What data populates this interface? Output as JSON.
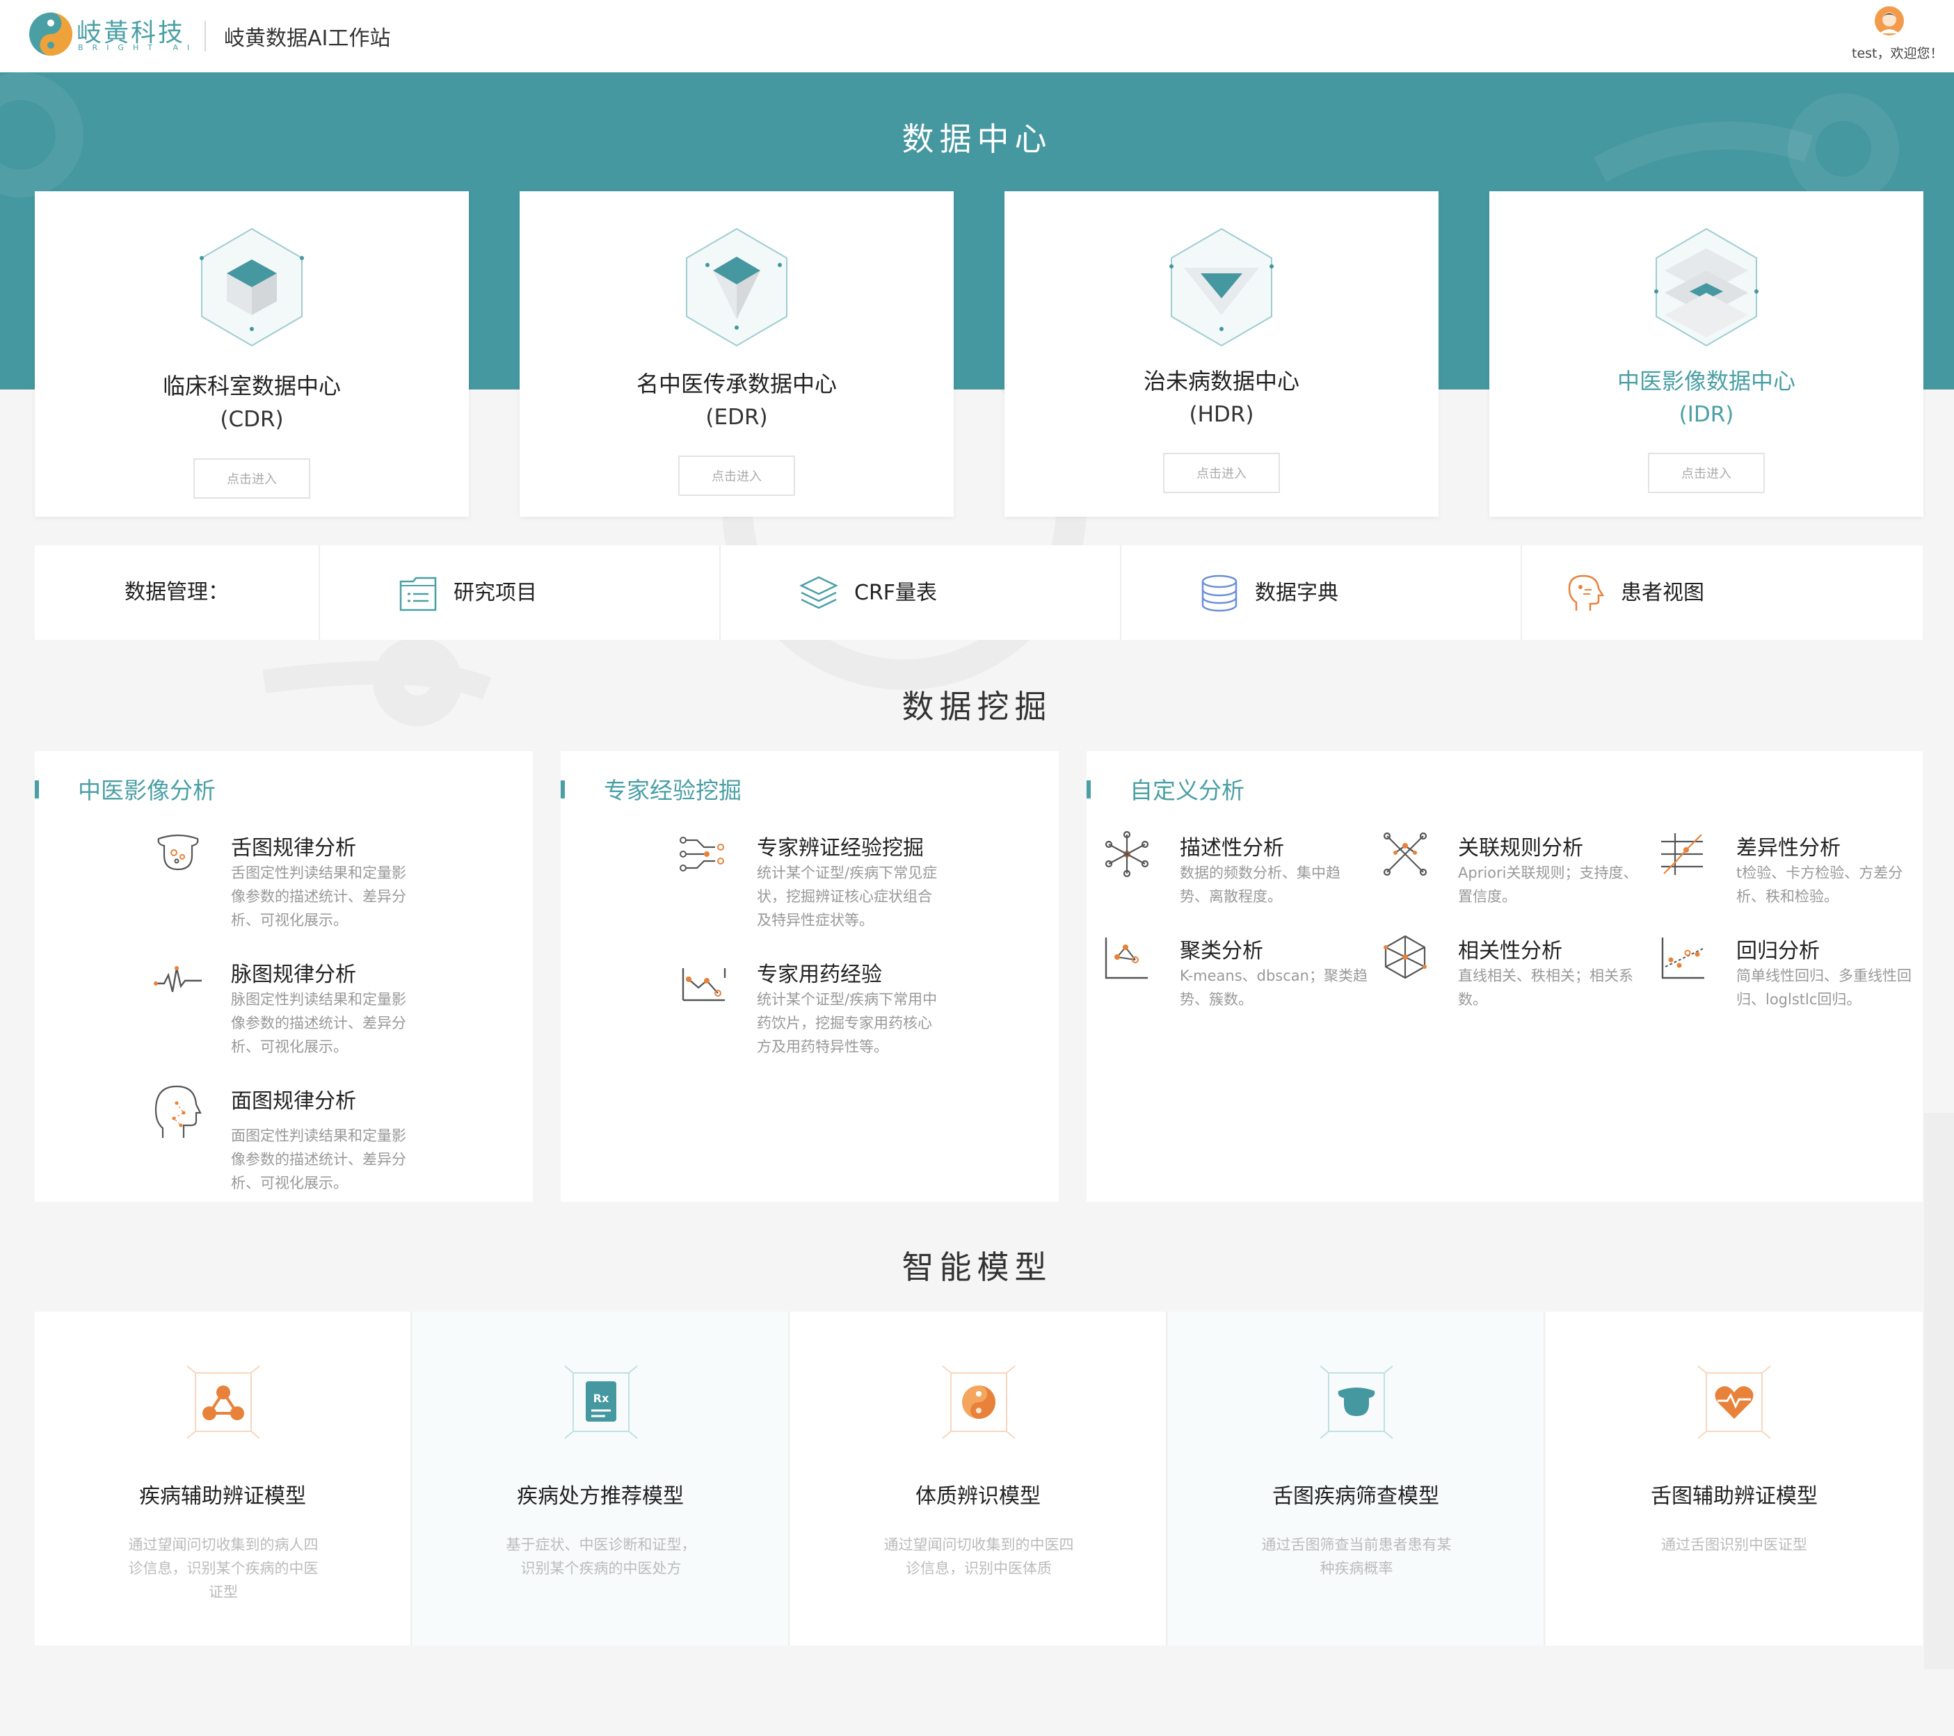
{
  "header": {
    "logo_cn": "岐黃科技",
    "logo_en": "BRIGHT AI",
    "app_title": "岐黄数据AI工作站",
    "welcome": "test，欢迎您！",
    "avatar_icon": "user-avatar-icon"
  },
  "data_center": {
    "title": "数据中心",
    "cards": [
      {
        "name": "临床科室数据中心",
        "code": "(CDR)",
        "button": "点击进入",
        "icon": "cube-layers-icon"
      },
      {
        "name": "名中医传承数据中心",
        "code": "(EDR)",
        "button": "点击进入",
        "icon": "cube-diamond-icon"
      },
      {
        "name": "治未病数据中心",
        "code": "(HDR)",
        "button": "点击进入",
        "icon": "cube-triangle-icon"
      },
      {
        "name": "中医影像数据中心",
        "code": "(IDR)",
        "button": "点击进入",
        "icon": "cube-stack-icon"
      }
    ]
  },
  "data_management": {
    "label": "数据管理：",
    "items": [
      {
        "label": "研究项目",
        "icon": "list-icon"
      },
      {
        "label": "CRF量表",
        "icon": "layers-icon"
      },
      {
        "label": "数据字典",
        "icon": "database-icon"
      },
      {
        "label": "患者视图",
        "icon": "head-profile-icon"
      }
    ]
  },
  "data_mining": {
    "title": "数据挖掘",
    "panels": [
      {
        "title": "中医影像分析",
        "items": [
          {
            "title": "舌图规律分析",
            "desc": "舌图定性判读结果和定量影像参数的描述统计、差异分析、可视化展示。",
            "icon": "tongue-icon"
          },
          {
            "title": "脉图规律分析",
            "desc": "脉图定性判读结果和定量影像参数的描述统计、差异分析、可视化展示。",
            "icon": "pulse-icon"
          },
          {
            "title": "面图规律分析",
            "desc": "面图定性判读结果和定量影像参数的描述统计、差异分析、可视化展示。",
            "icon": "face-icon"
          }
        ]
      },
      {
        "title": "专家经验挖掘",
        "items": [
          {
            "title": "专家辨证经验挖掘",
            "desc": "统计某个证型/疾病下常见症状，挖掘辨证核心症状组合及特异性症状等。",
            "icon": "flow-icon"
          },
          {
            "title": "专家用药经验",
            "desc": "统计某个证型/疾病下常用中药饮片，挖掘专家用药核心方及用药特异性等。",
            "icon": "trend-chart-icon"
          }
        ]
      },
      {
        "title": "自定义分析",
        "items": [
          {
            "title": "描述性分析",
            "desc": "数据的频数分析、集中趋势、离散程度。",
            "icon": "molecule-icon"
          },
          {
            "title": "关联规则分析",
            "desc": "Apriori关联规则；支持度、置信度。",
            "icon": "network-icon"
          },
          {
            "title": "差异性分析",
            "desc": "t检验、卡方检验、方差分析、秩和检验。",
            "icon": "difference-icon"
          },
          {
            "title": "聚类分析",
            "desc": "K-means、dbscan；聚类趋势、簇数。",
            "icon": "cluster-icon"
          },
          {
            "title": "相关性分析",
            "desc": "直线相关、秩相关；相关系数。",
            "icon": "correlation-icon"
          },
          {
            "title": "回归分析",
            "desc": "简单线性回归、多重线性回归、loglstlc回归。",
            "icon": "regression-icon"
          }
        ]
      }
    ]
  },
  "smart_models": {
    "title": "智能模型",
    "items": [
      {
        "name": "疾病辅助辨证模型",
        "desc": "通过望闻问切收集到的病人四诊信息，识别某个疾病的中医证型",
        "icon": "molecule-model-icon"
      },
      {
        "name": "疾病处方推荐模型",
        "desc": "基于症状、中医诊断和证型，识别某个疾病的中医处方",
        "icon": "prescription-icon"
      },
      {
        "name": "体质辨识模型",
        "desc": "通过望闻问切收集到的中医四诊信息，识别中医体质",
        "icon": "yin-yang-icon"
      },
      {
        "name": "舌图疾病筛查模型",
        "desc": "通过舌图筛查当前患者患有某种疾病概率",
        "icon": "tongue-model-icon"
      },
      {
        "name": "舌图辅助辨证模型",
        "desc": "通过舌图识别中医证型",
        "icon": "heart-pulse-icon"
      }
    ]
  },
  "colors": {
    "brand": "#4597a0",
    "accent_orange": "#e8823a",
    "text_dark": "#222222",
    "text_muted": "#999999"
  }
}
